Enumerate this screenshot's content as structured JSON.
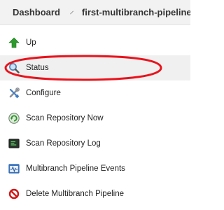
{
  "breadcrumb": {
    "items": [
      "Dashboard",
      "first-multibranch-pipeline"
    ]
  },
  "tasks": [
    {
      "label": "Up",
      "icon": "up-arrow-icon"
    },
    {
      "label": "Status",
      "icon": "search-icon"
    },
    {
      "label": "Configure",
      "icon": "configure-tools-icon"
    },
    {
      "label": "Scan Repository Now",
      "icon": "refresh-icon"
    },
    {
      "label": "Scan Repository Log",
      "icon": "terminal-icon"
    },
    {
      "label": "Multibranch Pipeline Events",
      "icon": "event-log-icon"
    },
    {
      "label": "Delete Multibranch Pipeline",
      "icon": "delete-icon"
    }
  ],
  "colors": {
    "highlight_ring": "#e8131c",
    "up_arrow": "#2e9a2e",
    "delete": "#d01515",
    "active_row": "#f0f0f0"
  }
}
